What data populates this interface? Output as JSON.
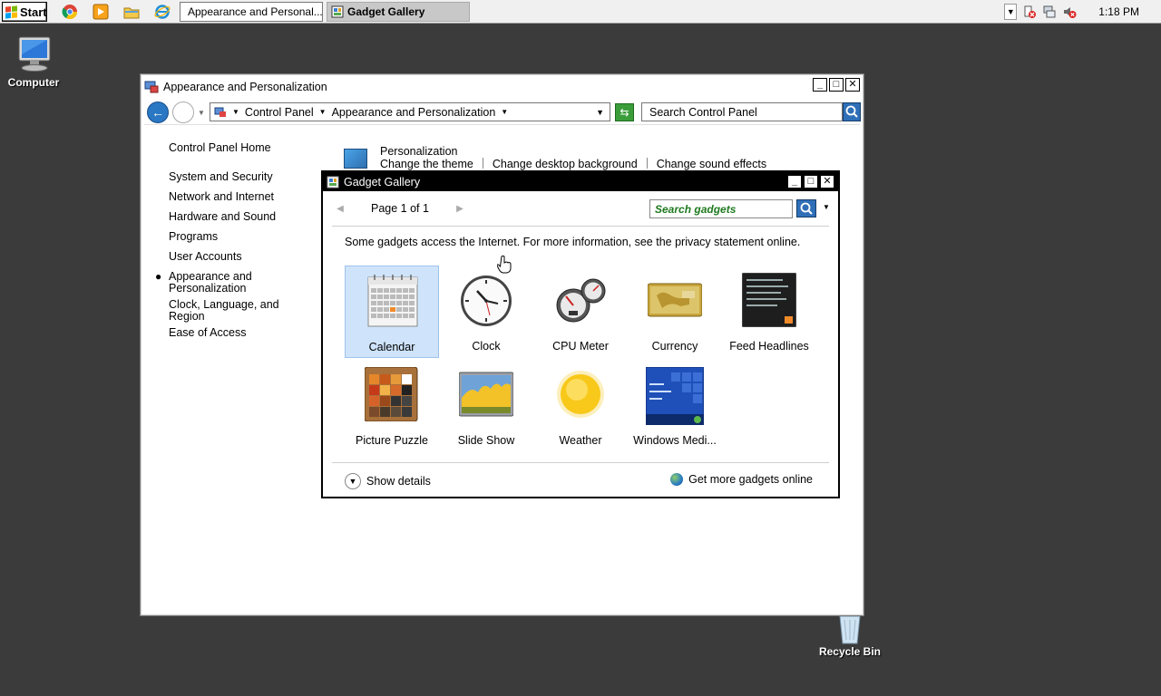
{
  "taskbar": {
    "start_label": "Start",
    "tasks": [
      {
        "label": "Appearance and Personal..."
      },
      {
        "label": "Gadget Gallery"
      }
    ],
    "clock": "1:18 PM"
  },
  "desktop": {
    "computer_label": "Computer",
    "recycle_label": "Recycle Bin"
  },
  "control_panel": {
    "title": "Appearance and Personalization",
    "breadcrumb": [
      "Control Panel",
      "Appearance and Personalization"
    ],
    "search_placeholder": "Search Control Panel",
    "sidebar": [
      {
        "label": "Control Panel Home"
      },
      {
        "label": "System and Security"
      },
      {
        "label": "Network and Internet"
      },
      {
        "label": "Hardware and Sound"
      },
      {
        "label": "Programs"
      },
      {
        "label": "User Accounts"
      },
      {
        "label": "Appearance and Personalization",
        "lines": [
          "Appearance and",
          "Personalization"
        ],
        "current": true
      },
      {
        "label": "Clock, Language, and Region",
        "lines": [
          "Clock, Language, and",
          "Region"
        ]
      },
      {
        "label": "Ease of Access"
      }
    ],
    "personalization": {
      "title": "Personalization",
      "links": [
        "Change the theme",
        "Change desktop background",
        "Change sound effects"
      ]
    }
  },
  "gadget_gallery": {
    "title": "Gadget Gallery",
    "page_label": "Page 1 of 1",
    "search_placeholder": "Search gadgets",
    "note": "Some gadgets access the Internet.  For more information, see the privacy statement online.",
    "gadgets": [
      {
        "label": "Calendar",
        "icon": "calendar-icon",
        "selected": true
      },
      {
        "label": "Clock",
        "icon": "clock-icon"
      },
      {
        "label": "CPU Meter",
        "icon": "cpu-meter-icon"
      },
      {
        "label": "Currency",
        "icon": "currency-icon"
      },
      {
        "label": "Feed Headlines",
        "icon": "feed-headlines-icon"
      },
      {
        "label": "Picture Puzzle",
        "icon": "picture-puzzle-icon"
      },
      {
        "label": "Slide Show",
        "icon": "slide-show-icon"
      },
      {
        "label": "Weather",
        "icon": "weather-icon"
      },
      {
        "label": "Windows Medi...",
        "icon": "windows-media-center-icon"
      }
    ],
    "show_details": "Show details",
    "more_online": "Get more gadgets online"
  }
}
